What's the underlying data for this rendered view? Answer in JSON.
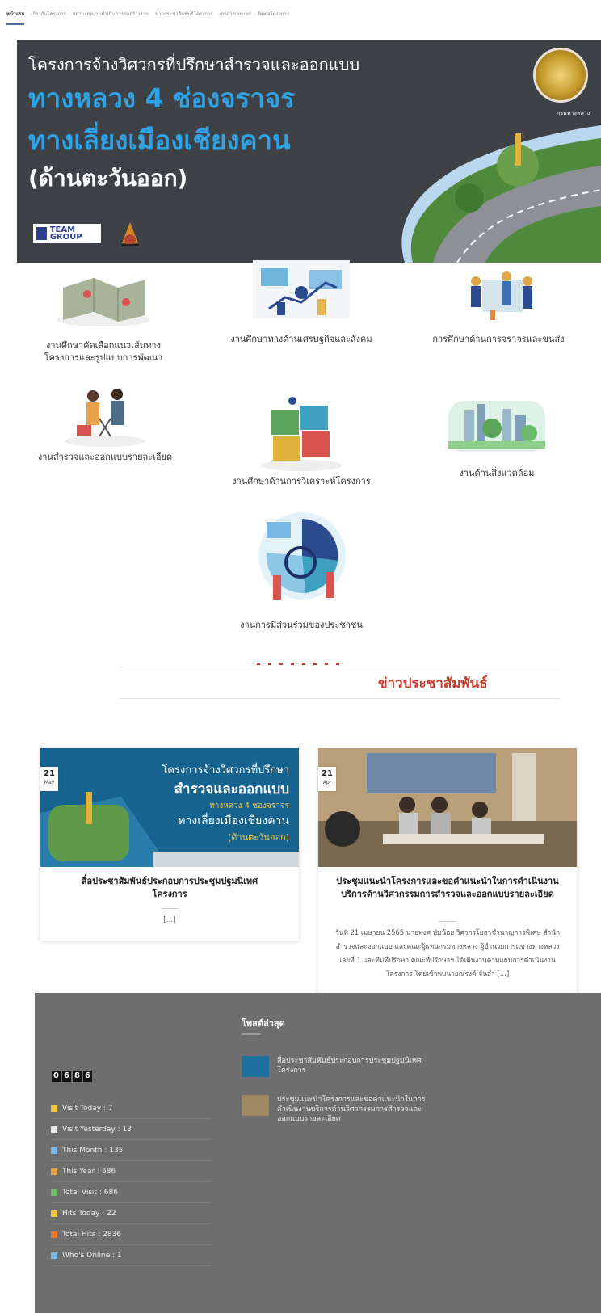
{
  "nav": {
    "items": [
      "หน้าแรก",
      "เกี่ยวกับโครงการ",
      "สถานะผลงานดำเนินการก่อสร้างงาน",
      "ข่าวประชาสัมพันธ์โครงการ",
      "เอกสารเผยแพร่",
      "ติดต่อโครงการ"
    ]
  },
  "hero": {
    "heading": "โครงการจ้างวิศวกรที่ปรึกษาสำรวจและออกแบบ",
    "line2": "ทางหลวง 4 ช่องจราจร",
    "line3": "ทางเลี่ยงเมืองเชียงคาน",
    "line4": "(ด้านตะวันออก)",
    "seal_label": "กรมทางหลวง",
    "team_logo_text": "TEAM GROUP"
  },
  "services": [
    {
      "label": "งานศึกษาคัดเลือกแนวเส้นทาง",
      "label2": "โครงการและรูปแบบการพัฒนา",
      "icon": "map-icon"
    },
    {
      "label": "งานศึกษาทางด้านเศรษฐกิจและสังคม",
      "icon": "economy-icon"
    },
    {
      "label": "การศึกษาด้านการจราจรและขนส่ง",
      "icon": "traffic-icon"
    },
    {
      "label": "งานสำรวจและออกแบบรายละเอียด",
      "icon": "survey-icon"
    },
    {
      "label": "งานศึกษาด้านการวิเคราะห์โครงการ",
      "icon": "puzzle-icon"
    },
    {
      "label": "งานด้านสิ่งแวดล้อม",
      "icon": "environment-icon"
    },
    {
      "label": "งานการมีส่วนร่วมของประชาชน",
      "icon": "participation-icon"
    }
  ],
  "news": {
    "title": "ข่าวประชาสัมพันธ์",
    "cards": [
      {
        "day": "21",
        "month": "May",
        "img_text_1": "โครงการจ้างวิศวกรที่ปรึกษา",
        "img_text_2": "สำรวจและออกแบบ",
        "img_text_3": "ทางหลวง 4 ช่องจราจร",
        "img_text_4": "ทางเลี่ยงเมืองเชียงคาน",
        "img_text_5": "(ด้านตะวันออก)",
        "title": "สื่อประชาสัมพันธ์ประกอบการประชุมปฐมนิเทศโครงการ",
        "excerpt": "[…]"
      },
      {
        "day": "21",
        "month": "Apr",
        "title": "ประชุมแนะนำโครงการและขอคำแนะนำในการดำเนินงานบริการด้านวิศวกรรมการสำรวจและออกแบบรายละเอียด",
        "excerpt": "วันที่ 21 เมษายน 2565 นายพงศ ปุ่มน้อย วิศวกรโยธาชำนาญการพิเศษ สำนักสำรวจและออกแบบ และคณะผู้แทนกรมทางหลวง ผู้อำนวยการแขวงทางหลวงเลยที่ 1 และทีมที่ปรึกษา คณะที่ปรึกษาฯ ได้เดินงานตามแผนการดำเนินงานโครงการ โดยเข้าพบนายณรงค์ จันอ่ำ […]"
      }
    ]
  },
  "footer": {
    "counter_digits": [
      "0",
      "6",
      "8",
      "6"
    ],
    "stats": [
      {
        "label": "Visit Today : 7",
        "color": "#f2c744"
      },
      {
        "label": "Visit Yesterday : 13",
        "color": "#e9e9e9"
      },
      {
        "label": "This Month : 135",
        "color": "#7ab8e8"
      },
      {
        "label": "This Year : 686",
        "color": "#e8a34a"
      },
      {
        "label": "Total Visit : 686",
        "color": "#6fbf6a"
      },
      {
        "label": "Hits Today : 22",
        "color": "#f2c744"
      },
      {
        "label": "Total Hits : 2836",
        "color": "#e57e3a"
      },
      {
        "label": "Who's Online : 1",
        "color": "#7ab8e8"
      }
    ],
    "recent_title": "โพสต์ล่าสุด",
    "recent_posts": [
      "สื่อประชาสัมพันธ์ประกอบการประชุมปฐมนิเทศโครงการ",
      "ประชุมแนะนำโครงการและขอคำแนะนำในการดำเนินงานบริการด้านวิศวกรรมการสำรวจและออกแบบรายละเอียด"
    ]
  },
  "colors": {
    "accent_blue": "#2ea3e6",
    "news_red": "#c8392b",
    "hero_bg": "#3e4145",
    "footer_bg": "#6e6e6e"
  }
}
